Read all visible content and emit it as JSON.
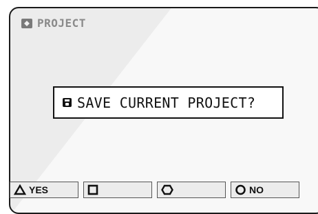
{
  "header": {
    "icon": "project-icon",
    "title": "PROJECT"
  },
  "dialog": {
    "icon": "floppy-disk-icon",
    "text": "SAVE CURRENT PROJECT?"
  },
  "softkeys": [
    {
      "icon": "triangle-icon",
      "label": "YES"
    },
    {
      "icon": "square-icon",
      "label": ""
    },
    {
      "icon": "hexagon-icon",
      "label": ""
    },
    {
      "icon": "circle-icon",
      "label": "NO"
    }
  ]
}
